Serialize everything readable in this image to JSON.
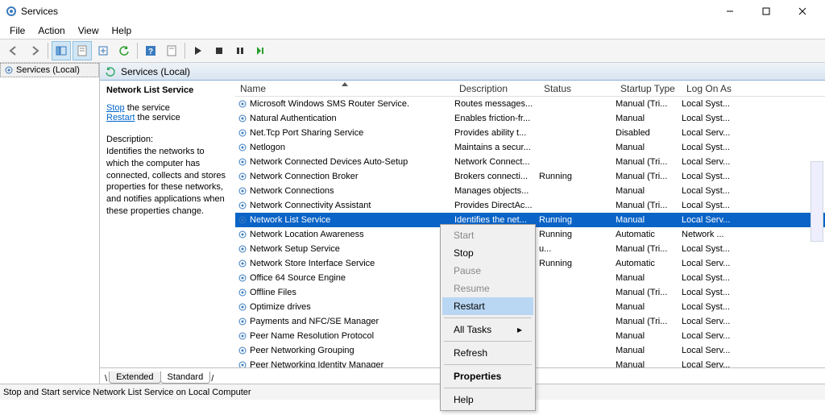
{
  "window": {
    "title": "Services"
  },
  "menubar": [
    "File",
    "Action",
    "View",
    "Help"
  ],
  "tree": {
    "root": "Services (Local)"
  },
  "panel": {
    "header": "Services (Local)"
  },
  "info": {
    "svcname": "Network List Service",
    "actions": {
      "stop": "Stop",
      "restart": "Restart",
      "suffix": " the service"
    },
    "dlabel": "Description:",
    "dbody": "Identifies the networks to which the computer has connected, collects and stores properties for these networks, and notifies applications when these properties change."
  },
  "columns": {
    "name": "Name",
    "desc": "Description",
    "status": "Status",
    "start": "Startup Type",
    "logon": "Log On As"
  },
  "services": [
    {
      "n": "Microsoft Windows SMS Router Service.",
      "d": "Routes messages...",
      "s": "",
      "t": "Manual (Tri...",
      "l": "Local Syst..."
    },
    {
      "n": "Natural Authentication",
      "d": "Enables friction-fr...",
      "s": "",
      "t": "Manual",
      "l": "Local Syst..."
    },
    {
      "n": "Net.Tcp Port Sharing Service",
      "d": "Provides ability t...",
      "s": "",
      "t": "Disabled",
      "l": "Local Serv..."
    },
    {
      "n": "Netlogon",
      "d": "Maintains a secur...",
      "s": "",
      "t": "Manual",
      "l": "Local Syst..."
    },
    {
      "n": "Network Connected Devices Auto-Setup",
      "d": "Network Connect...",
      "s": "",
      "t": "Manual (Tri...",
      "l": "Local Serv..."
    },
    {
      "n": "Network Connection Broker",
      "d": "Brokers connecti...",
      "s": "Running",
      "t": "Manual (Tri...",
      "l": "Local Syst..."
    },
    {
      "n": "Network Connections",
      "d": "Manages objects...",
      "s": "",
      "t": "Manual",
      "l": "Local Syst..."
    },
    {
      "n": "Network Connectivity Assistant",
      "d": "Provides DirectAc...",
      "s": "",
      "t": "Manual (Tri...",
      "l": "Local Syst..."
    },
    {
      "n": "Network List Service",
      "d": "Identifies the net...",
      "s": "Running",
      "t": "Manual",
      "l": "Local Serv...",
      "sel": true
    },
    {
      "n": "Network Location Awareness",
      "d": "",
      "s": "Running",
      "t": "Automatic",
      "l": "Network ..."
    },
    {
      "n": "Network Setup Service",
      "d": "",
      "s": "u...",
      "t": "Manual (Tri...",
      "l": "Local Syst..."
    },
    {
      "n": "Network Store Interface Service",
      "d": "",
      "s": "Running",
      "t": "Automatic",
      "l": "Local Serv..."
    },
    {
      "n": "Office 64 Source Engine",
      "d": "...",
      "s": "",
      "t": "Manual",
      "l": "Local Syst..."
    },
    {
      "n": "Offline Files",
      "d": "",
      "s": "",
      "t": "Manual (Tri...",
      "l": "Local Syst..."
    },
    {
      "n": "Optimize drives",
      "d": "",
      "s": "",
      "t": "Manual",
      "l": "Local Syst..."
    },
    {
      "n": "Payments and NFC/SE Manager",
      "d": "",
      "s": "",
      "t": "Manual (Tri...",
      "l": "Local Serv..."
    },
    {
      "n": "Peer Name Resolution Protocol",
      "d": "...",
      "s": "",
      "t": "Manual",
      "l": "Local Serv..."
    },
    {
      "n": "Peer Networking Grouping",
      "d": "...",
      "s": "",
      "t": "Manual",
      "l": "Local Serv..."
    },
    {
      "n": "Peer Networking Identity Manager",
      "d": "...",
      "s": "",
      "t": "Manual",
      "l": "Local Serv..."
    }
  ],
  "context": {
    "start": "Start",
    "stop": "Stop",
    "pause": "Pause",
    "resume": "Resume",
    "restart": "Restart",
    "alltasks": "All Tasks",
    "refresh": "Refresh",
    "properties": "Properties",
    "help": "Help"
  },
  "tabs": {
    "extended": "Extended",
    "standard": "Standard"
  },
  "statusbar": "Stop and Start service Network List Service on Local Computer"
}
